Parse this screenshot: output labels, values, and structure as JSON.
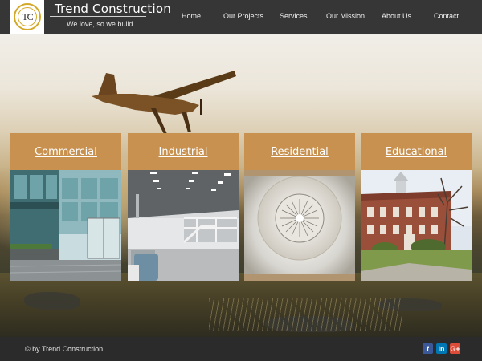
{
  "brand": {
    "logo_text": "TC",
    "title": "Trend Construction",
    "tagline": "We love, so we build"
  },
  "nav": {
    "items": [
      {
        "label": "Home"
      },
      {
        "label": "Our Projects"
      },
      {
        "label": "Services"
      },
      {
        "label": "Our Mission"
      },
      {
        "label": "About Us"
      },
      {
        "label": "Contact"
      }
    ]
  },
  "cards": [
    {
      "label": "Commercial",
      "image": "glass-building-entrance"
    },
    {
      "label": "Industrial",
      "image": "warehouse-interior"
    },
    {
      "label": "Residential",
      "image": "ceiling-light-fixture"
    },
    {
      "label": "Educational",
      "image": "brick-school-building"
    }
  ],
  "footer": {
    "copyright": "© by Trend Construction",
    "social": [
      {
        "icon": "facebook-icon",
        "glyph": "f",
        "color": "#3b5998"
      },
      {
        "icon": "linkedin-icon",
        "glyph": "in",
        "color": "#0077b5"
      },
      {
        "icon": "google-plus-icon",
        "glyph": "G+",
        "color": "#dd4b39"
      }
    ]
  },
  "colors": {
    "header_bg": "#363636",
    "card_header": "#c8914f",
    "footer_bg": "#2b2b2b",
    "logo_ring": "#d4a92a"
  }
}
